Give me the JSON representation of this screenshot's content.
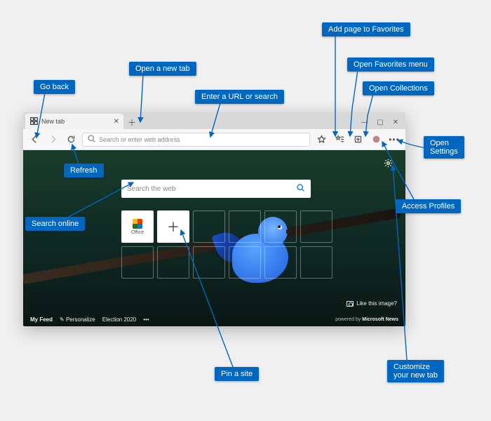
{
  "callouts": {
    "go_back": "Go back",
    "new_tab": "Open a new tab",
    "url_search": "Enter a URL or search",
    "add_fav": "Add page to Favorites",
    "fav_menu": "Open Favorites menu",
    "collections": "Open Collections",
    "settings": "Open\nSettings",
    "profiles": "Access Profiles",
    "customize": "Customize\nyour new tab",
    "pin": "Pin a site",
    "search_online": "Search online",
    "refresh": "Refresh"
  },
  "tab": {
    "title": "New tab"
  },
  "toolbar": {
    "address_placeholder": "Search or enter web address"
  },
  "page": {
    "search_placeholder": "Search the web",
    "tiles": {
      "office": "Office"
    },
    "like_image": "Like this image?",
    "feed": {
      "my_feed": "My Feed",
      "personalize": "Personalize",
      "election": "Election 2020",
      "more": "•••",
      "powered_prefix": "powered by",
      "powered_brand": "Microsoft News"
    }
  }
}
